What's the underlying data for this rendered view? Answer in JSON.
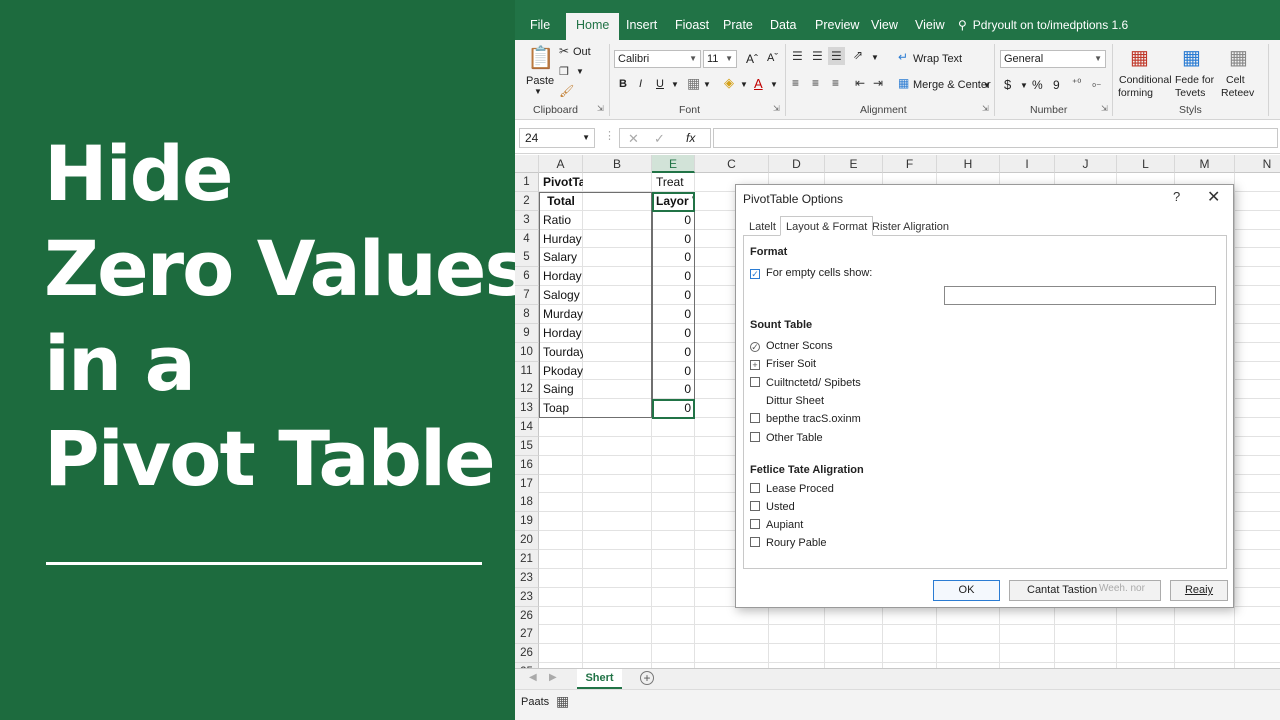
{
  "headline": {
    "lines": [
      "Hide",
      "Zero Values",
      "in a",
      "Pivot Table"
    ]
  },
  "ribbon_tabs": [
    "File",
    "Home",
    "Insert",
    "Fioast",
    "Prate",
    "Data",
    "Preview",
    "View",
    "Vieiw"
  ],
  "active_tab": "Home",
  "tell_me": "Pdryoult on to/imedptions 1.6",
  "ribbon": {
    "clipboard": {
      "paste": "Paste",
      "cut": "Out",
      "group": "Clipboard"
    },
    "font": {
      "name": "Calibri",
      "size": "11",
      "group": "Font",
      "bold": "B",
      "italic": "I",
      "underline": "U",
      "grow": "Aˆ",
      "shrink": "Aˇ"
    },
    "alignment": {
      "wrap": "Wrap Text",
      "merge": "Merge & Center",
      "group": "Alignment"
    },
    "number": {
      "format": "General",
      "currency": "$",
      "percent": "%",
      "comma": "9",
      "group": "Number"
    },
    "styles": {
      "conditional_1": "Conditional",
      "conditional_2": "forming",
      "format_1": "Fede for",
      "format_2": "Tevets",
      "cell_1": "Celt",
      "cell_2": "Reteev",
      "group": "Styls"
    }
  },
  "name_box": "24",
  "fx_label": "fx",
  "columns": [
    "A",
    "B",
    "E",
    "C",
    "D",
    "E",
    "F",
    "H",
    "I",
    "J",
    "L",
    "M",
    "N"
  ],
  "selected_column": "E",
  "rows": [
    "1",
    "2",
    "3",
    "4",
    "5",
    "6",
    "7",
    "8",
    "9",
    "10",
    "11",
    "12",
    "13",
    "14",
    "15",
    "16",
    "17",
    "18",
    "19",
    "20",
    "21",
    "23",
    "23",
    "26",
    "27",
    "26",
    "25"
  ],
  "pivot": {
    "a1": "PivotTable",
    "a2": "Total",
    "e1": "Treat",
    "e2": "Layor Vadues",
    "labels": [
      "Ratio",
      "Hurday",
      "Salary",
      "Horday",
      "Salogy",
      "Murday",
      "Horday",
      "Tourday",
      "Pkoday",
      "Saing",
      "Toap"
    ],
    "values": [
      "0",
      "0",
      "0",
      "0",
      "0",
      "0",
      "0",
      "0",
      "0",
      "0",
      "0"
    ]
  },
  "sheet_tab": "Shert",
  "status_text": "Paats",
  "dialog": {
    "title": "PivotTable Options",
    "help": "?",
    "close": "✕",
    "tabs": [
      "Latelt",
      "Layout & Format",
      "Rister Aligration"
    ],
    "active_tab": "Layout & Format",
    "format_heading": "Format",
    "empty_cells_label": "For empty cells show:",
    "empty_cells_value": "",
    "section2_heading": "Sount Table",
    "section2_options": [
      {
        "label": "Octner Scons",
        "state": "radio"
      },
      {
        "label": "Friser Soit",
        "state": "plus"
      },
      {
        "label": "Cuiltnctetd/ Spibets",
        "state": "off"
      },
      {
        "label": "Dittur Sheet",
        "state": "none"
      },
      {
        "label": "bepthe tracS.oxinm",
        "state": "off"
      },
      {
        "label": "Other Table",
        "state": "off"
      }
    ],
    "section3_heading": "Fetlice Tate Aligration",
    "section3_options": [
      "Lease Proced",
      "Usted",
      "Aupiant",
      "Roury Pable"
    ],
    "buttons": {
      "ok": "OK",
      "cancel": "Cantat Tastion",
      "mid": "Weeh. nor",
      "ready": "Reaiy"
    }
  },
  "colors": {
    "green_panel": "#1d6b3e",
    "excel_green": "#217346",
    "dialog_accent": "#2b7cd3"
  }
}
